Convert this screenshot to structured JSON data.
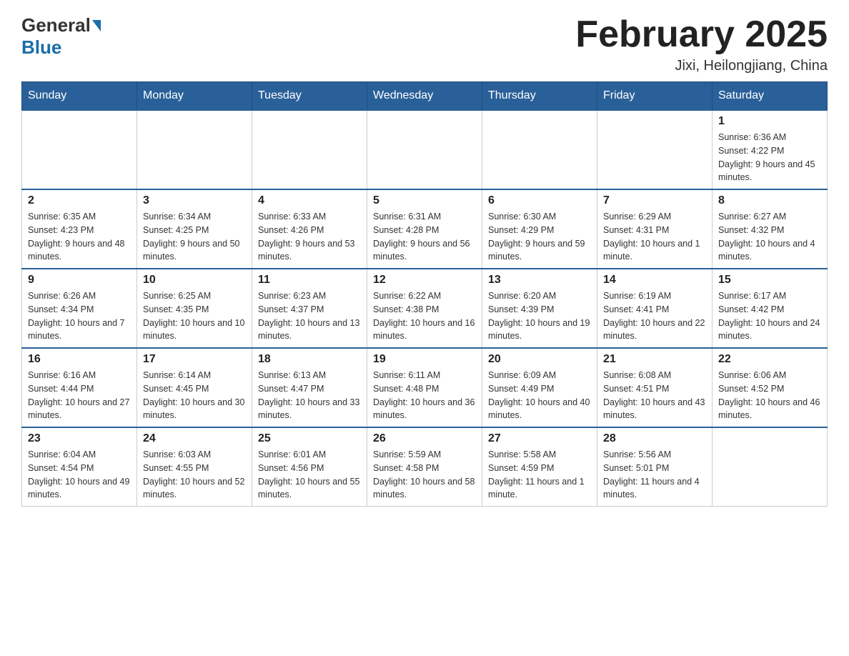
{
  "header": {
    "logo_general": "General",
    "logo_blue": "Blue",
    "title": "February 2025",
    "subtitle": "Jixi, Heilongjiang, China"
  },
  "days_of_week": [
    "Sunday",
    "Monday",
    "Tuesday",
    "Wednesday",
    "Thursday",
    "Friday",
    "Saturday"
  ],
  "weeks": [
    [
      {
        "day": "",
        "info": ""
      },
      {
        "day": "",
        "info": ""
      },
      {
        "day": "",
        "info": ""
      },
      {
        "day": "",
        "info": ""
      },
      {
        "day": "",
        "info": ""
      },
      {
        "day": "",
        "info": ""
      },
      {
        "day": "1",
        "info": "Sunrise: 6:36 AM\nSunset: 4:22 PM\nDaylight: 9 hours and 45 minutes."
      }
    ],
    [
      {
        "day": "2",
        "info": "Sunrise: 6:35 AM\nSunset: 4:23 PM\nDaylight: 9 hours and 48 minutes."
      },
      {
        "day": "3",
        "info": "Sunrise: 6:34 AM\nSunset: 4:25 PM\nDaylight: 9 hours and 50 minutes."
      },
      {
        "day": "4",
        "info": "Sunrise: 6:33 AM\nSunset: 4:26 PM\nDaylight: 9 hours and 53 minutes."
      },
      {
        "day": "5",
        "info": "Sunrise: 6:31 AM\nSunset: 4:28 PM\nDaylight: 9 hours and 56 minutes."
      },
      {
        "day": "6",
        "info": "Sunrise: 6:30 AM\nSunset: 4:29 PM\nDaylight: 9 hours and 59 minutes."
      },
      {
        "day": "7",
        "info": "Sunrise: 6:29 AM\nSunset: 4:31 PM\nDaylight: 10 hours and 1 minute."
      },
      {
        "day": "8",
        "info": "Sunrise: 6:27 AM\nSunset: 4:32 PM\nDaylight: 10 hours and 4 minutes."
      }
    ],
    [
      {
        "day": "9",
        "info": "Sunrise: 6:26 AM\nSunset: 4:34 PM\nDaylight: 10 hours and 7 minutes."
      },
      {
        "day": "10",
        "info": "Sunrise: 6:25 AM\nSunset: 4:35 PM\nDaylight: 10 hours and 10 minutes."
      },
      {
        "day": "11",
        "info": "Sunrise: 6:23 AM\nSunset: 4:37 PM\nDaylight: 10 hours and 13 minutes."
      },
      {
        "day": "12",
        "info": "Sunrise: 6:22 AM\nSunset: 4:38 PM\nDaylight: 10 hours and 16 minutes."
      },
      {
        "day": "13",
        "info": "Sunrise: 6:20 AM\nSunset: 4:39 PM\nDaylight: 10 hours and 19 minutes."
      },
      {
        "day": "14",
        "info": "Sunrise: 6:19 AM\nSunset: 4:41 PM\nDaylight: 10 hours and 22 minutes."
      },
      {
        "day": "15",
        "info": "Sunrise: 6:17 AM\nSunset: 4:42 PM\nDaylight: 10 hours and 24 minutes."
      }
    ],
    [
      {
        "day": "16",
        "info": "Sunrise: 6:16 AM\nSunset: 4:44 PM\nDaylight: 10 hours and 27 minutes."
      },
      {
        "day": "17",
        "info": "Sunrise: 6:14 AM\nSunset: 4:45 PM\nDaylight: 10 hours and 30 minutes."
      },
      {
        "day": "18",
        "info": "Sunrise: 6:13 AM\nSunset: 4:47 PM\nDaylight: 10 hours and 33 minutes."
      },
      {
        "day": "19",
        "info": "Sunrise: 6:11 AM\nSunset: 4:48 PM\nDaylight: 10 hours and 36 minutes."
      },
      {
        "day": "20",
        "info": "Sunrise: 6:09 AM\nSunset: 4:49 PM\nDaylight: 10 hours and 40 minutes."
      },
      {
        "day": "21",
        "info": "Sunrise: 6:08 AM\nSunset: 4:51 PM\nDaylight: 10 hours and 43 minutes."
      },
      {
        "day": "22",
        "info": "Sunrise: 6:06 AM\nSunset: 4:52 PM\nDaylight: 10 hours and 46 minutes."
      }
    ],
    [
      {
        "day": "23",
        "info": "Sunrise: 6:04 AM\nSunset: 4:54 PM\nDaylight: 10 hours and 49 minutes."
      },
      {
        "day": "24",
        "info": "Sunrise: 6:03 AM\nSunset: 4:55 PM\nDaylight: 10 hours and 52 minutes."
      },
      {
        "day": "25",
        "info": "Sunrise: 6:01 AM\nSunset: 4:56 PM\nDaylight: 10 hours and 55 minutes."
      },
      {
        "day": "26",
        "info": "Sunrise: 5:59 AM\nSunset: 4:58 PM\nDaylight: 10 hours and 58 minutes."
      },
      {
        "day": "27",
        "info": "Sunrise: 5:58 AM\nSunset: 4:59 PM\nDaylight: 11 hours and 1 minute."
      },
      {
        "day": "28",
        "info": "Sunrise: 5:56 AM\nSunset: 5:01 PM\nDaylight: 11 hours and 4 minutes."
      },
      {
        "day": "",
        "info": ""
      }
    ]
  ]
}
